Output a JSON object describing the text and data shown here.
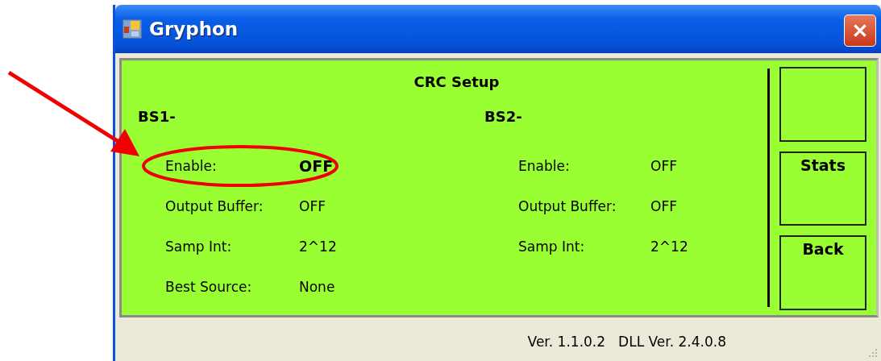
{
  "window": {
    "title": "Gryphon"
  },
  "panel": {
    "title": "CRC Setup",
    "sections": [
      {
        "header": "BS1-",
        "fields": [
          {
            "label": "Enable:",
            "value": "OFF",
            "emphasized": true,
            "highlighted": true
          },
          {
            "label": "Output Buffer:",
            "value": "OFF",
            "emphasized": false,
            "highlighted": false
          },
          {
            "label": "Samp Int:",
            "value": "2^12",
            "emphasized": false,
            "highlighted": false
          },
          {
            "label": "Best Source:",
            "value": "None",
            "emphasized": false,
            "highlighted": false
          }
        ]
      },
      {
        "header": "BS2-",
        "fields": [
          {
            "label": "Enable:",
            "value": "OFF",
            "emphasized": false,
            "highlighted": false
          },
          {
            "label": "Output Buffer:",
            "value": "OFF",
            "emphasized": false,
            "highlighted": false
          },
          {
            "label": "Samp Int:",
            "value": "2^12",
            "emphasized": false,
            "highlighted": false
          }
        ]
      }
    ],
    "buttons": [
      {
        "kind": "blank"
      },
      {
        "kind": "text",
        "label": "Stats"
      },
      {
        "kind": "text",
        "label": "Back"
      }
    ]
  },
  "status_bar": [
    "Ver. 1.1.0.2",
    "DLL Ver. 2.4.0.8"
  ]
}
